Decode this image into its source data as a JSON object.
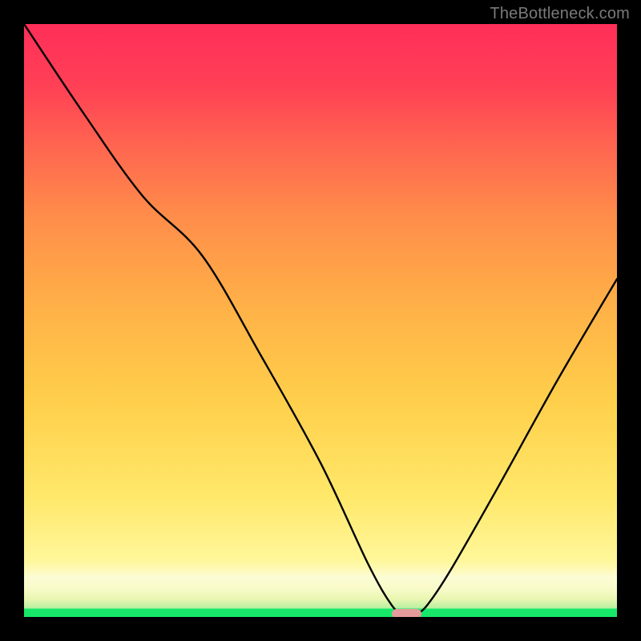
{
  "watermark": "TheBottleneck.com",
  "chart_data": {
    "type": "line",
    "title": "",
    "xlabel": "",
    "ylabel": "",
    "xlim": [
      0,
      100
    ],
    "ylim": [
      0,
      100
    ],
    "series": [
      {
        "name": "bottleneck-curve",
        "x": [
          0,
          10,
          20,
          30,
          40,
          50,
          58,
          62,
          64,
          66,
          68,
          72,
          80,
          90,
          100
        ],
        "y": [
          100,
          85,
          71,
          61,
          44,
          26,
          9,
          2,
          0.5,
          0.5,
          2,
          8,
          22,
          40,
          57
        ]
      }
    ],
    "marker": {
      "x_start": 62,
      "x_end": 67,
      "y": 0.5
    },
    "background": {
      "type": "vertical-gradient",
      "stops": [
        {
          "pos": 0.0,
          "color": "#17e86a"
        },
        {
          "pos": 0.015,
          "color": "#17e86a"
        },
        {
          "pos": 0.03,
          "color": "#e8f6b0"
        },
        {
          "pos": 0.07,
          "color": "#fcfcd5"
        },
        {
          "pos": 0.1,
          "color": "#fff79b"
        },
        {
          "pos": 0.25,
          "color": "#ffe86a"
        },
        {
          "pos": 0.45,
          "color": "#ffb347"
        },
        {
          "pos": 0.7,
          "color": "#ff8d4a"
        },
        {
          "pos": 0.85,
          "color": "#ff5a50"
        },
        {
          "pos": 1.0,
          "color": "#ff2e59"
        }
      ]
    }
  }
}
